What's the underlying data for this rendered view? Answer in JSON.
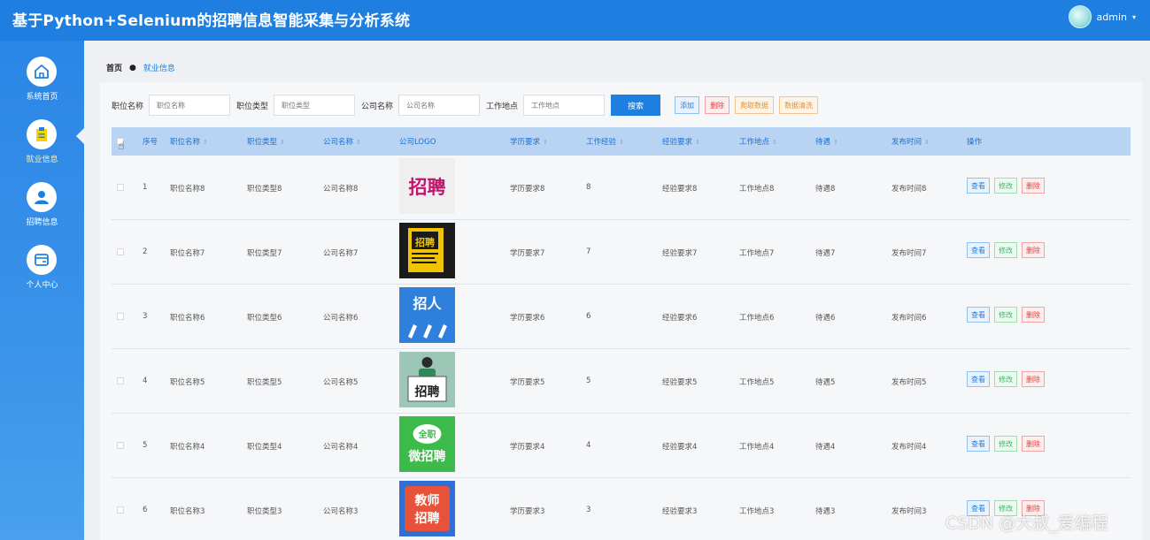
{
  "app": {
    "title": "基于Python+Selenium的招聘信息智能采集与分析系统"
  },
  "user": {
    "name": "admin",
    "caret": "▾"
  },
  "sidebar": {
    "items": [
      {
        "label": "系统首页",
        "icon": "home-icon"
      },
      {
        "label": "就业信息",
        "icon": "clipboard-icon",
        "active": true
      },
      {
        "label": "招聘信息",
        "icon": "user-icon"
      },
      {
        "label": "个人中心",
        "icon": "wallet-icon"
      }
    ]
  },
  "breadcrumb": {
    "home": "首页",
    "separator": "●",
    "current": "就业信息"
  },
  "filters": {
    "job_name": {
      "label": "职位名称",
      "placeholder": "职位名称"
    },
    "job_type": {
      "label": "职位类型",
      "placeholder": "职位类型"
    },
    "company": {
      "label": "公司名称",
      "placeholder": "公司名称"
    },
    "location": {
      "label": "工作地点",
      "placeholder": "工作地点"
    },
    "search": "搜索",
    "add": "添加",
    "delete": "删除",
    "crawl": "爬取数据",
    "clean": "数据清洗"
  },
  "table": {
    "sort_glyph": "⇕",
    "columns": {
      "index": "序号",
      "job_name": "职位名称",
      "job_type": "职位类型",
      "company": "公司名称",
      "logo": "公司LOGO",
      "education": "学历要求",
      "years": "工作经验",
      "experience": "经验要求",
      "location": "工作地点",
      "benefits": "待遇",
      "publish": "发布时间",
      "actions": "操作"
    },
    "rows": [
      {
        "index": "1",
        "job_name": "职位名称8",
        "job_type": "职位类型8",
        "company": "公司名称8",
        "logo_text": "招聘",
        "logo_style": "script",
        "education": "学历要求8",
        "years": "8",
        "experience": "经验要求8",
        "location": "工作地点8",
        "benefits": "待遇8",
        "publish": "发布时间8"
      },
      {
        "index": "2",
        "job_name": "职位名称7",
        "job_type": "职位类型7",
        "company": "公司名称7",
        "logo_text": "招聘",
        "logo_style": "poster",
        "education": "学历要求7",
        "years": "7",
        "experience": "经验要求7",
        "location": "工作地点7",
        "benefits": "待遇7",
        "publish": "发布时间7"
      },
      {
        "index": "3",
        "job_name": "职位名称6",
        "job_type": "职位类型6",
        "company": "公司名称6",
        "logo_text": "招人",
        "logo_style": "hands",
        "education": "学历要求6",
        "years": "6",
        "experience": "经验要求6",
        "location": "工作地点6",
        "benefits": "待遇6",
        "publish": "发布时间6"
      },
      {
        "index": "4",
        "job_name": "职位名称5",
        "job_type": "职位类型5",
        "company": "公司名称5",
        "logo_text": "招聘",
        "logo_style": "person",
        "education": "学历要求5",
        "years": "5",
        "experience": "经验要求5",
        "location": "工作地点5",
        "benefits": "待遇5",
        "publish": "发布时间5"
      },
      {
        "index": "5",
        "job_name": "职位名称4",
        "job_type": "职位类型4",
        "company": "公司名称4",
        "logo_text": "全职微招聘",
        "logo_style": "green",
        "education": "学历要求4",
        "years": "4",
        "experience": "经验要求4",
        "location": "工作地点4",
        "benefits": "待遇4",
        "publish": "发布时间4"
      },
      {
        "index": "6",
        "job_name": "职位名称3",
        "job_type": "职位类型3",
        "company": "公司名称3",
        "logo_text": "教师招聘",
        "logo_style": "teacher",
        "education": "学历要求3",
        "years": "3",
        "experience": "经验要求3",
        "location": "工作地点3",
        "benefits": "待遇3",
        "publish": "发布时间3"
      }
    ],
    "actions": {
      "view": "查看",
      "edit": "修改",
      "delete": "删除"
    }
  },
  "watermark": "CSDN @大叔_爱编程",
  "colors": {
    "primary": "#1e7fe0",
    "header_row": "#b9d3f2",
    "success": "#3fb56a",
    "danger": "#e04040",
    "warning": "#e6922e"
  }
}
